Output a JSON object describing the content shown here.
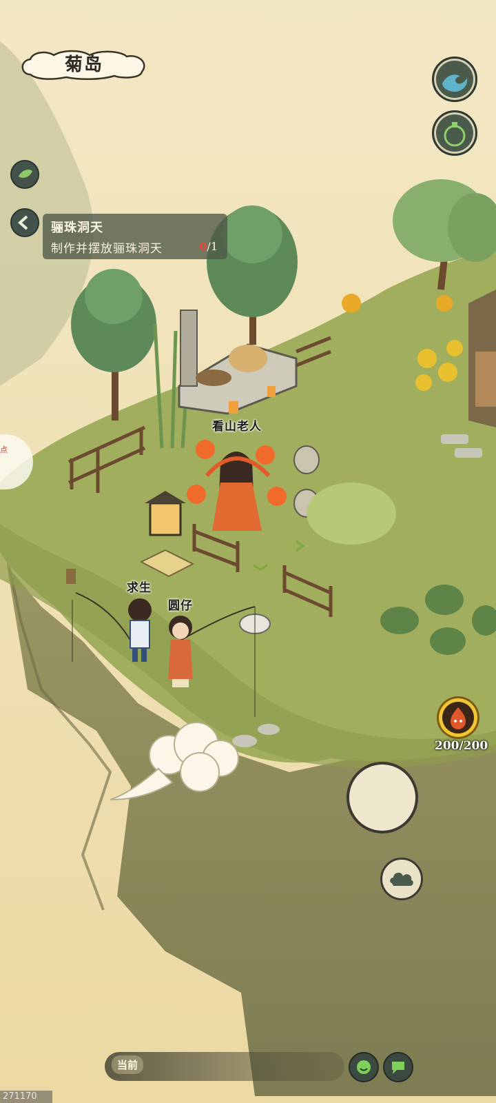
{
  "location": {
    "name": "菊岛"
  },
  "quest": {
    "title": "骊珠洞天",
    "description": "制作并摆放骊珠洞天",
    "progress_done": "0",
    "progress_total": "/1"
  },
  "npcs": [
    {
      "name": "看山老人"
    },
    {
      "name": "求生"
    },
    {
      "name": "圆仔"
    }
  ],
  "energy": {
    "value": "200/200"
  },
  "chat": {
    "channel_label": "当前"
  },
  "left_tab": {
    "text": "点"
  },
  "build": {
    "id": "271170"
  },
  "icons": {
    "top_right_1": "wave-icon",
    "top_right_2": "gourd-icon",
    "leaf_button": "leaf-icon",
    "quest_collapse": "chevron-left-icon",
    "cloud_action": "cloud-icon",
    "emoji": "smile-icon",
    "chat": "chat-bubble-icon"
  },
  "colors": {
    "grass": "#9cac5c",
    "cliff": "#8c8a5a",
    "sky": "#efe2b8",
    "accent_red": "#e24a3a"
  }
}
